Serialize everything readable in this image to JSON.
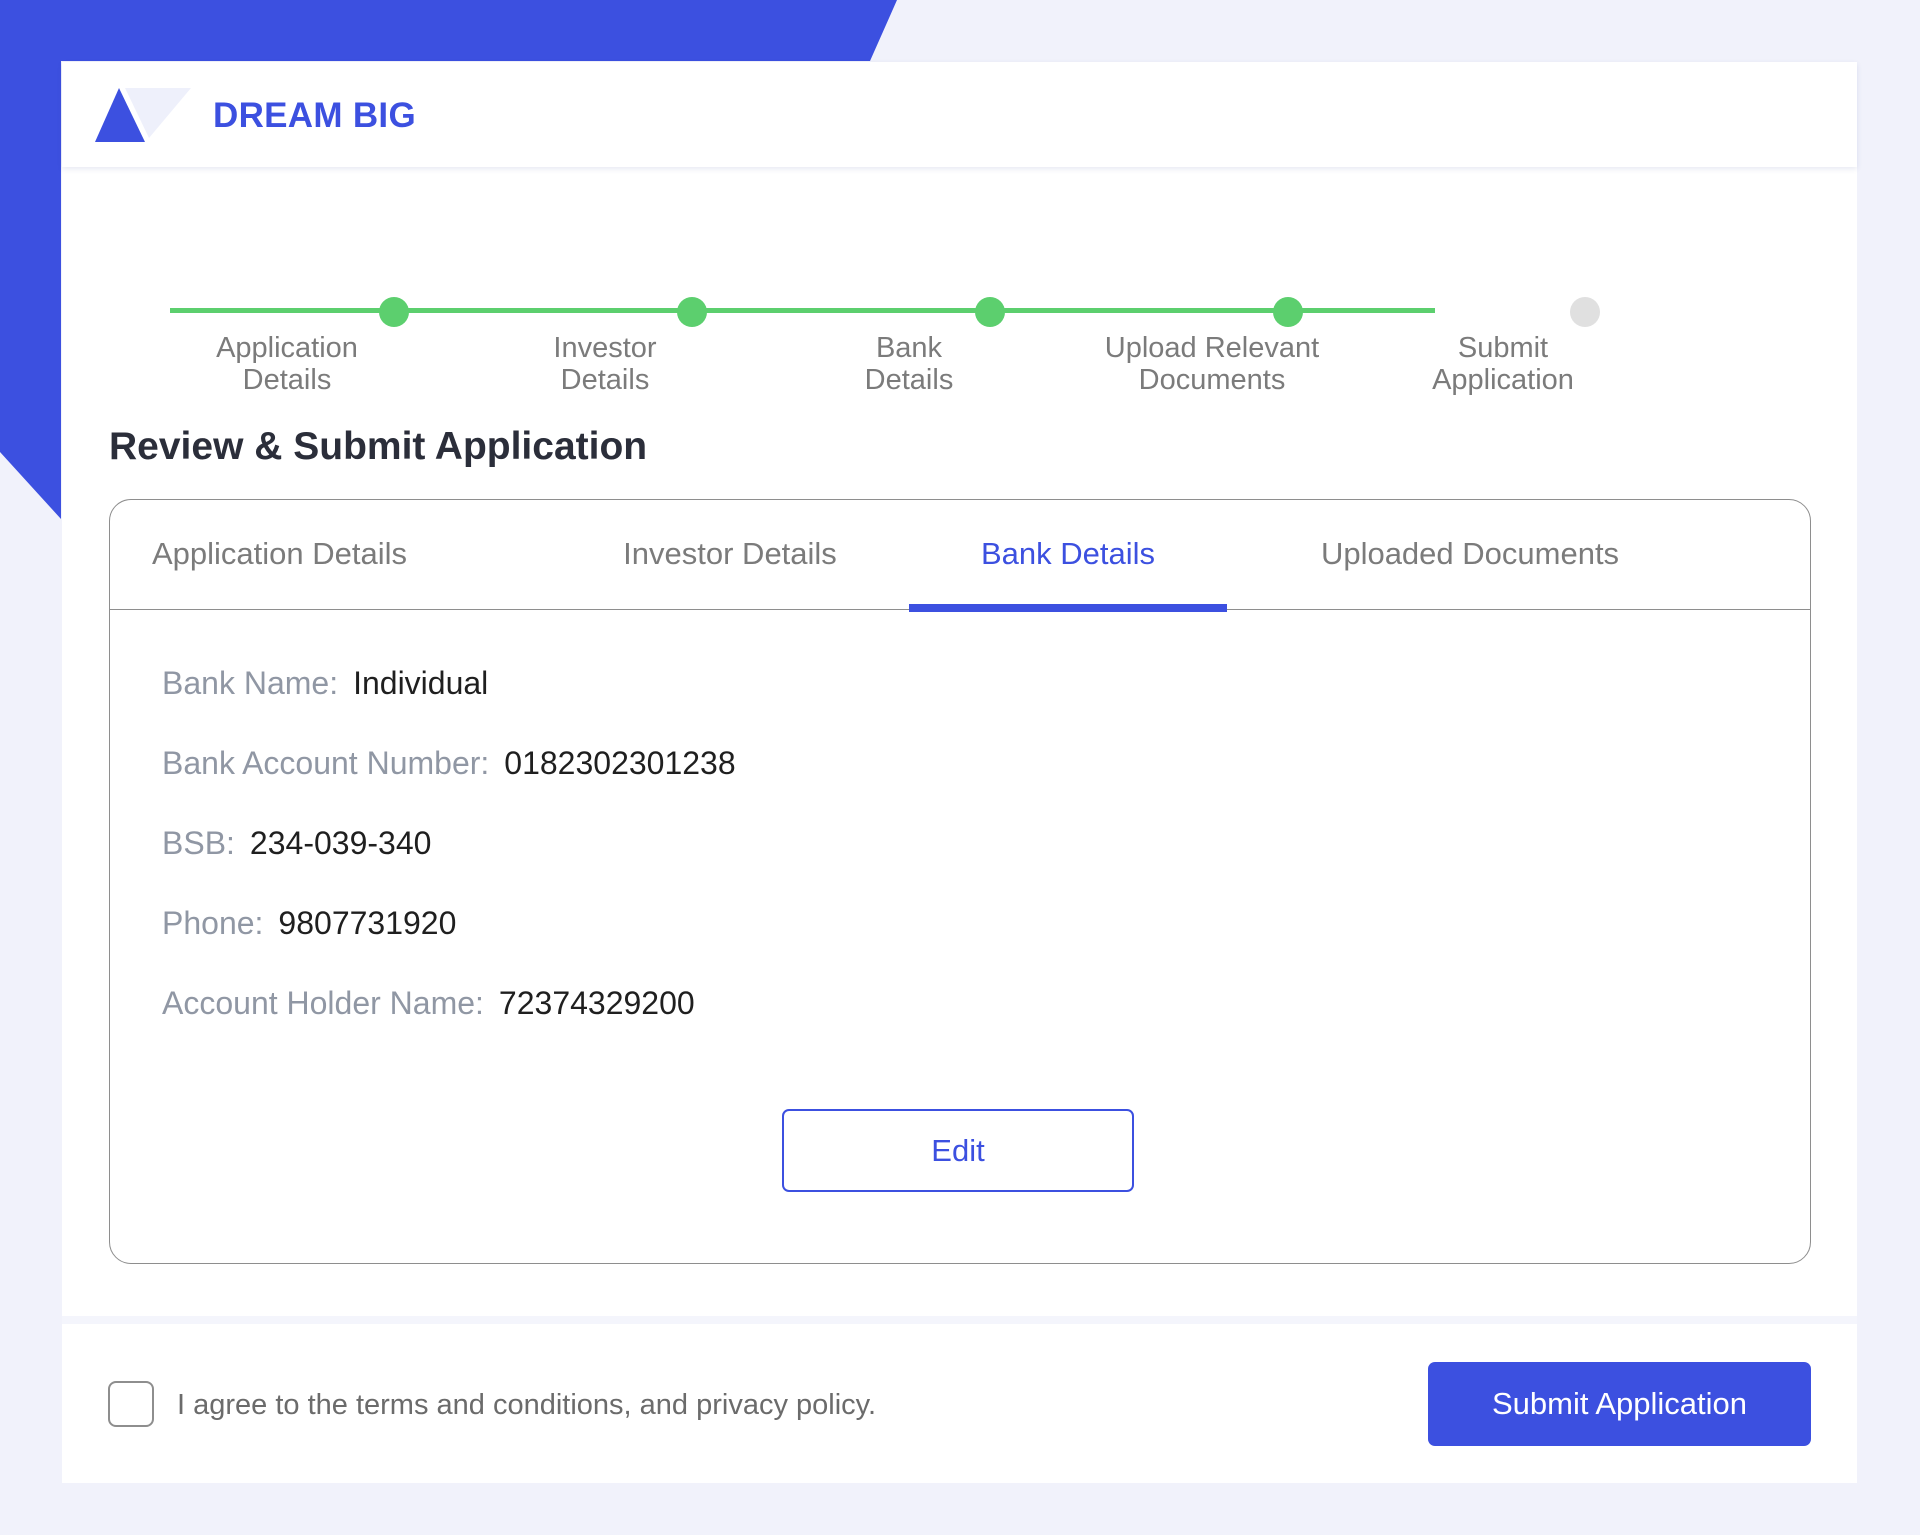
{
  "brand": {
    "name": "DREAM BIG"
  },
  "colors": {
    "accent": "#3c50e0",
    "success": "#5ccf6e",
    "pending": "#e0e0e0"
  },
  "stepper": {
    "steps": [
      {
        "line1": "Application",
        "line2": "Details",
        "status": "complete"
      },
      {
        "line1": "Investor",
        "line2": "Details",
        "status": "complete"
      },
      {
        "line1": "Bank",
        "line2": "Details",
        "status": "complete"
      },
      {
        "line1": "Upload Relevant",
        "line2": "Documents",
        "status": "complete"
      },
      {
        "line1": "Submit",
        "line2": "Application",
        "status": "pending"
      }
    ]
  },
  "page": {
    "title": "Review & Submit Application"
  },
  "tabs": [
    {
      "label": "Application Details",
      "active": false
    },
    {
      "label": "Investor Details",
      "active": false
    },
    {
      "label": "Bank Details",
      "active": true
    },
    {
      "label": "Uploaded Documents",
      "active": false
    }
  ],
  "bank_details": {
    "fields": [
      {
        "label": "Bank Name:",
        "value": "Individual"
      },
      {
        "label": "Bank Account Number:",
        "value": "0182302301238"
      },
      {
        "label": "BSB:",
        "value": "234-039-340"
      },
      {
        "label": "Phone:",
        "value": "9807731920"
      },
      {
        "label": "Account Holder Name:",
        "value": "72374329200"
      }
    ],
    "edit_label": "Edit"
  },
  "footer": {
    "agree_text": "I agree to the terms and conditions, and privacy policy.",
    "agree_checked": false,
    "submit_label": "Submit Application"
  }
}
